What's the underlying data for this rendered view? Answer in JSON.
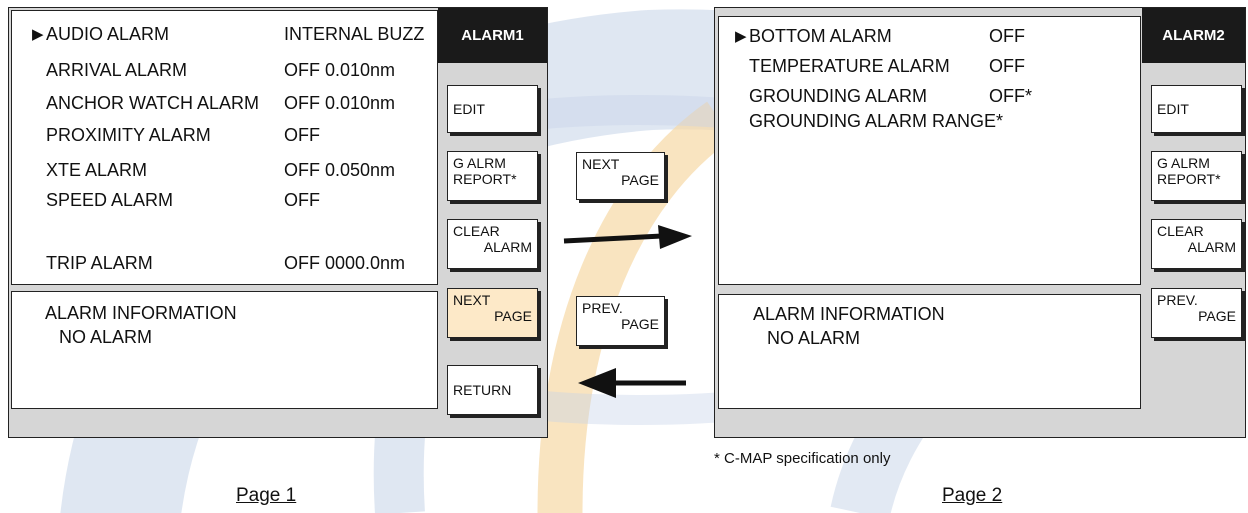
{
  "page1": {
    "title": "ALARM1",
    "selected_marker": "▶",
    "rows": [
      {
        "label": "AUDIO ALARM",
        "value": "INTERNAL BUZZ"
      },
      {
        "label": "ARRIVAL ALARM",
        "value": "OFF 0.010nm"
      },
      {
        "label": "ANCHOR WATCH ALARM",
        "value": "OFF 0.010nm"
      },
      {
        "label": "PROXIMITY ALARM",
        "value": "OFF"
      },
      {
        "label": "XTE ALARM",
        "value": "OFF  0.050nm"
      },
      {
        "label": "SPEED ALARM",
        "value": "OFF"
      },
      {
        "label": "TRIP ALARM",
        "value": "OFF 0000.0nm"
      }
    ],
    "info_title": "ALARM INFORMATION",
    "info_value": "NO ALARM",
    "buttons": {
      "edit": "EDIT",
      "g_alrm_1": "G ALRM",
      "g_alrm_2": "REPORT*",
      "clear_1": "CLEAR",
      "clear_2": "ALARM",
      "next_1": "NEXT",
      "next_2": "PAGE",
      "return": "RETURN"
    },
    "label": "Page 1"
  },
  "page2": {
    "title": "ALARM2",
    "selected_marker": "▶",
    "rows": [
      {
        "label": "BOTTOM ALARM",
        "value": "OFF"
      },
      {
        "label": "TEMPERATURE ALARM",
        "value": "OFF"
      },
      {
        "label": "GROUNDING ALARM",
        "value": "OFF*"
      },
      {
        "label": "GROUNDING ALARM RANGE*",
        "value": ""
      }
    ],
    "info_title": "ALARM INFORMATION",
    "info_value": "NO ALARM",
    "buttons": {
      "edit": "EDIT",
      "g_alrm_1": "G ALRM",
      "g_alrm_2": "REPORT*",
      "clear_1": "CLEAR",
      "clear_2": "ALARM",
      "prev_1": "PREV.",
      "prev_2": "PAGE"
    },
    "label": "Page 2",
    "footnote": "* C-MAP specification only"
  },
  "nav": {
    "next_1": "NEXT",
    "next_2": "PAGE",
    "prev_1": "PREV.",
    "prev_2": "PAGE"
  },
  "colors": {
    "watermark_blue": "#c5d3e8",
    "watermark_orange": "#f7d9a5",
    "title_bg": "#1a1a1a"
  }
}
